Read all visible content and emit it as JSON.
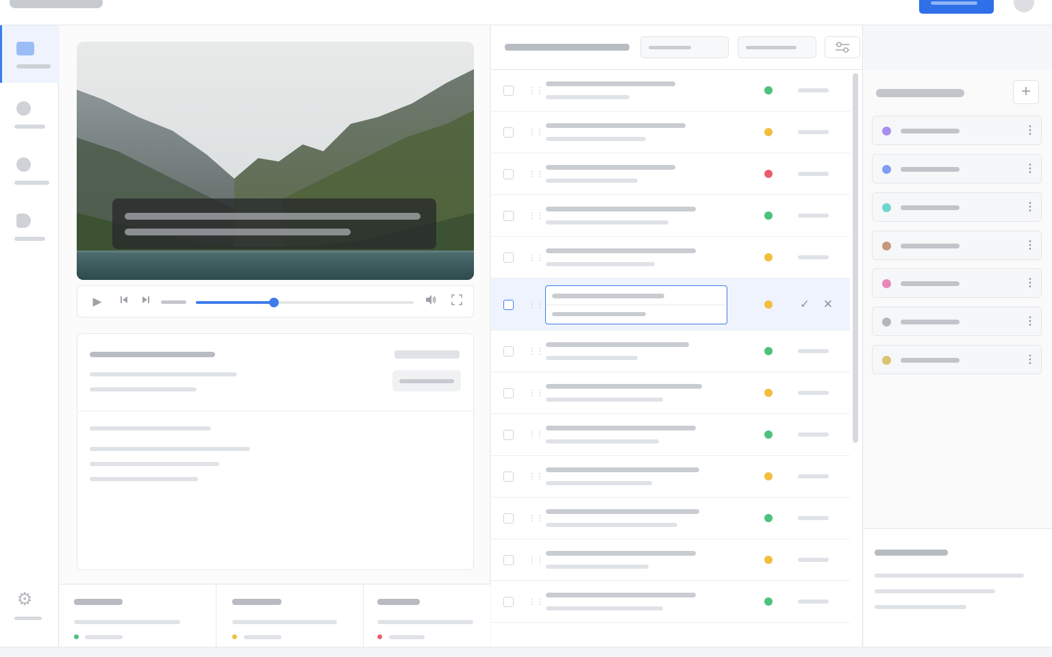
{
  "app": {
    "brand": "",
    "primary_action": "",
    "accent_color": "#2f6fe8"
  },
  "nav": {
    "items": [
      {
        "id": "media",
        "icon": "square-icon",
        "active": true
      },
      {
        "id": "item-2",
        "icon": "circle-icon",
        "active": false
      },
      {
        "id": "item-3",
        "icon": "circle-icon",
        "active": false
      },
      {
        "id": "item-4",
        "icon": "note-icon",
        "active": false
      }
    ],
    "settings_icon": "gear-icon"
  },
  "player": {
    "scene": "mountain-lake",
    "progress": 0.36,
    "controls": [
      "play-icon",
      "skip-back-icon",
      "skip-forward-icon",
      "volume-icon",
      "fullscreen-icon"
    ]
  },
  "stats": {
    "cards": [
      {
        "status_color": "#4cc27c"
      },
      {
        "status_color": "#f2be3e"
      },
      {
        "status_color": "#e8606d"
      }
    ]
  },
  "list": {
    "filter_icon": "sliders-icon",
    "rows": [
      {
        "status_color": "#4cc27c"
      },
      {
        "status_color": "#f2be3e"
      },
      {
        "status_color": "#e8606d"
      },
      {
        "status_color": "#4cc27c"
      },
      {
        "status_color": "#f2be3e"
      },
      {
        "status_color": "#f2be3e",
        "editing": true
      },
      {
        "status_color": "#4cc27c"
      },
      {
        "status_color": "#f2be3e"
      },
      {
        "status_color": "#4cc27c"
      },
      {
        "status_color": "#f2be3e"
      },
      {
        "status_color": "#4cc27c"
      },
      {
        "status_color": "#f2be3e"
      },
      {
        "status_color": "#4cc27c"
      }
    ],
    "status_colors": {
      "green": "#4cc27c",
      "yellow": "#f2be3e",
      "red": "#e8606d"
    }
  },
  "tags": {
    "add_icon": "plus-icon",
    "items": [
      {
        "color": "#a98ef0"
      },
      {
        "color": "#7f9df3"
      },
      {
        "color": "#6fd6cc"
      },
      {
        "color": "#c8987a"
      },
      {
        "color": "#e789b9"
      },
      {
        "color": "#b3b6bb"
      },
      {
        "color": "#d9c56e"
      }
    ]
  }
}
